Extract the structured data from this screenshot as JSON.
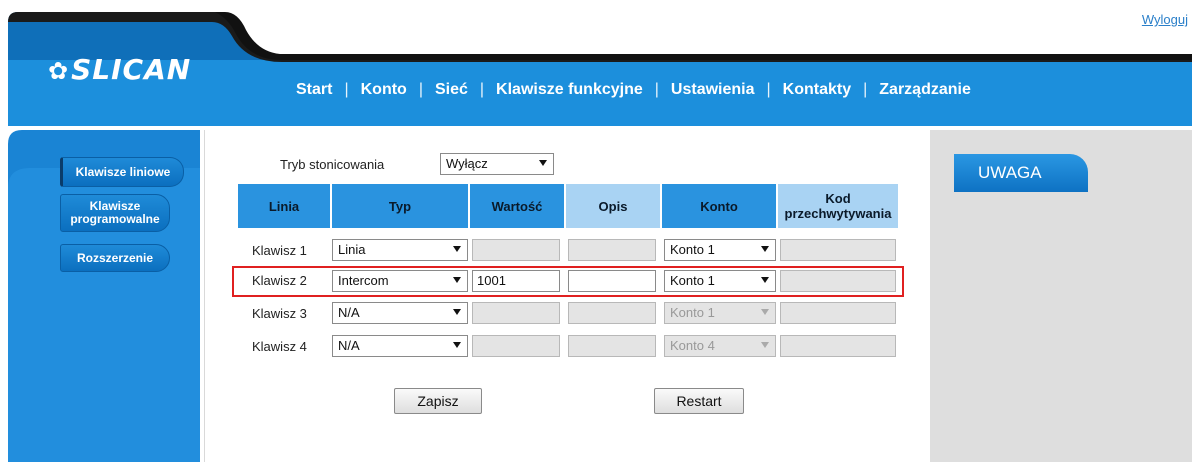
{
  "logout": "Wyloguj",
  "logo": {
    "text": "SLICAN"
  },
  "nav": {
    "items": [
      "Start",
      "Konto",
      "Sieć",
      "Klawisze funkcyjne",
      "Ustawienia",
      "Kontakty",
      "Zarządzanie"
    ],
    "active": "Klawisze funkcyjne"
  },
  "sidebar": {
    "items": [
      "Klawisze liniowe",
      "Klawisze programowalne",
      "Rozszerzenie"
    ],
    "active": "Klawisze liniowe"
  },
  "paging": {
    "label": "Tryb stonicowania",
    "value": "Wyłącz"
  },
  "table": {
    "headers": [
      "Linia",
      "Typ",
      "Wartość",
      "Opis",
      "Konto",
      "Kod przechwytywania"
    ],
    "rows": [
      {
        "label": "Klawisz 1",
        "typ": "Linia",
        "wartosc": "",
        "opis": "",
        "konto": "Konto 1",
        "konto_enabled": true,
        "fields_enabled": false
      },
      {
        "label": "Klawisz 2",
        "typ": "Intercom",
        "wartosc": "1001",
        "opis": "",
        "konto": "Konto 1",
        "konto_enabled": true,
        "fields_enabled": true,
        "highlighted": true
      },
      {
        "label": "Klawisz 3",
        "typ": "N/A",
        "wartosc": "",
        "opis": "",
        "konto": "Konto 1",
        "konto_enabled": false,
        "fields_enabled": false
      },
      {
        "label": "Klawisz 4",
        "typ": "N/A",
        "wartosc": "",
        "opis": "",
        "konto": "Konto 4",
        "konto_enabled": false,
        "fields_enabled": false
      }
    ]
  },
  "buttons": {
    "save": "Zapisz",
    "restart": "Restart"
  },
  "notice": {
    "title": "UWAGA"
  },
  "colors": {
    "accent": "#1a86d6",
    "highlight": "#e02020",
    "header_dark": "#222222"
  }
}
